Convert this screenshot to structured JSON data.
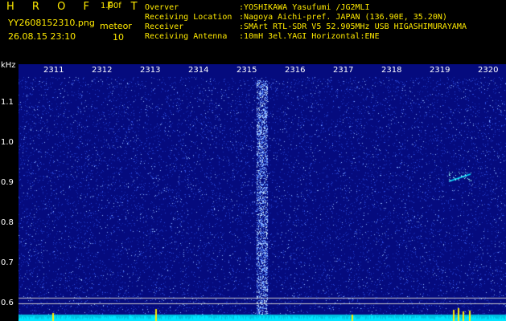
{
  "header": {
    "app_title": "H R O F F T",
    "version": "1.00f",
    "file_name": "YY2608152310.png",
    "datetime": "26.08.15 23:10",
    "meteor_label": "meteor",
    "meteor_count": "10"
  },
  "info": [
    {
      "key": "Overver",
      "value": ":YOSHIKAWA Yasufumi /JG2MLI"
    },
    {
      "key": "Receiving Location",
      "value": ":Nagoya Aichi-pref. JAPAN (136.90E, 35.20N)"
    },
    {
      "key": "Receiver",
      "value": ":SMArt RTL-SDR V5 52.905MHz USB HIGASHIMURAYAMA"
    },
    {
      "key": "Receiving Antenna",
      "value": ":10mH 3el.YAGI Horizontal:ENE"
    }
  ],
  "axis": {
    "unit": "kHz",
    "y_ticks": [
      "1.1",
      "1.0",
      "0.9",
      "0.8",
      "0.7",
      "0.6"
    ],
    "x_ticks": [
      "2311",
      "2312",
      "2313",
      "2314",
      "2315",
      "2316",
      "2317",
      "2318",
      "2319",
      "2320"
    ]
  },
  "colors": {
    "header_text": "#ffea00",
    "background": "#050b7e",
    "signal": "#00e5ff",
    "axis_text": "#ffffff"
  }
}
